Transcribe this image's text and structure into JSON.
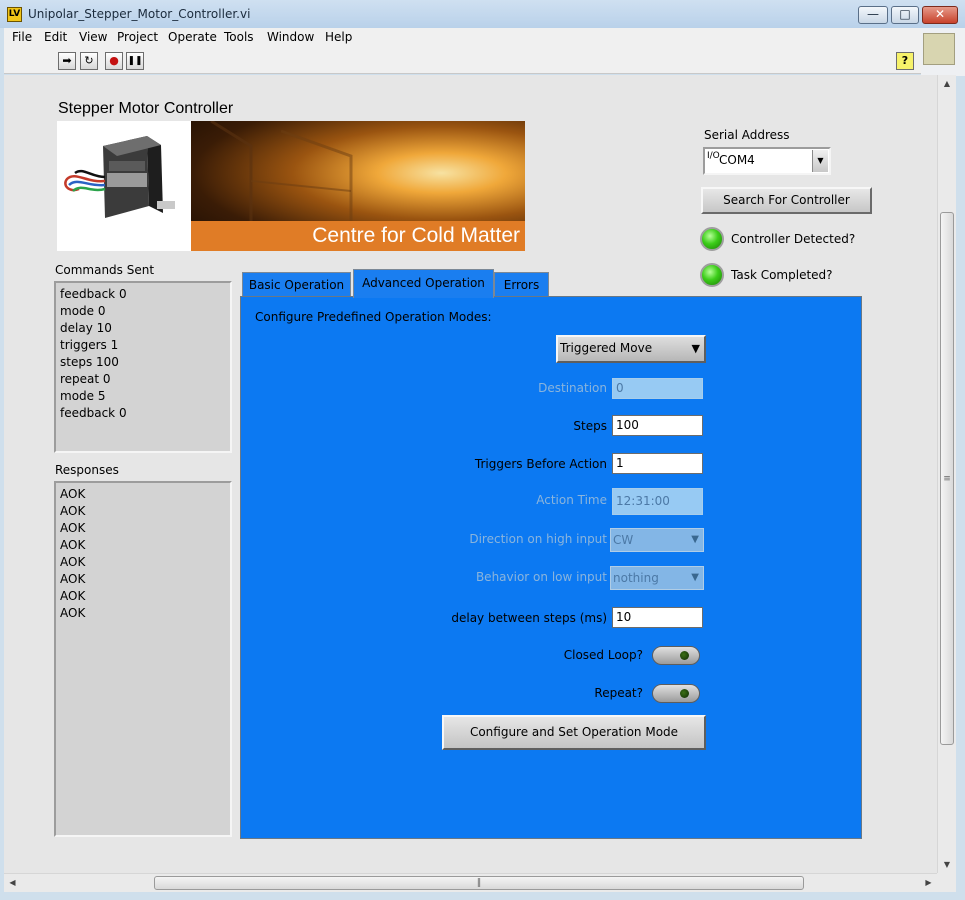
{
  "window": {
    "title": "Unipolar_Stepper_Motor_Controller.vi",
    "app_icon_glyph": "LV",
    "minimize_glyph": "—",
    "maximize_glyph": "□",
    "close_glyph": "✕"
  },
  "menu": [
    "File",
    "Edit",
    "View",
    "Project",
    "Operate",
    "Tools",
    "Window",
    "Help"
  ],
  "toolbar": {
    "icons": [
      "run-icon",
      "run-continuously-icon",
      "abort-icon",
      "pause-icon",
      "help-icon"
    ],
    "glyphs": {
      "run": "➡",
      "run_continuously": "↻",
      "abort": "●",
      "pause": "❚❚",
      "help": "?"
    }
  },
  "header": {
    "title": "Stepper Motor Controller"
  },
  "banner": {
    "text": "Centre for Cold Matter"
  },
  "commands": {
    "label": "Commands Sent",
    "items": [
      "feedback 0",
      "mode 0",
      "delay 10",
      "triggers 1",
      "steps 100",
      "repeat 0",
      "mode 5",
      "feedback 0"
    ]
  },
  "responses": {
    "label": "Responses",
    "items": [
      "AOK",
      "AOK",
      "AOK",
      "AOK",
      "AOK",
      "AOK",
      "AOK",
      "AOK"
    ]
  },
  "serial": {
    "label": "Serial Address",
    "io_glyph": "I/O",
    "value": "COM4",
    "arrow": "▼",
    "search_label": "Search For Controller"
  },
  "indicators": {
    "controller_label": "Controller Detected?",
    "controller_on": true,
    "task_label": "Task Completed?",
    "task_on": true,
    "led_color": "#3ccd19"
  },
  "tabs": {
    "basic": "Basic Operation",
    "advanced": "Advanced Operation",
    "errors": "Errors",
    "active": "advanced",
    "panel_color": "#0c79f2"
  },
  "advanced": {
    "heading": "Configure Predefined Operation Modes:",
    "mode_value": "Triggered Move",
    "mode_arrow": "▼",
    "destination_label": "Destination",
    "destination_value": "0",
    "steps_label": "Steps",
    "steps_value": "100",
    "triggers_label": "Triggers Before Action",
    "triggers_value": "1",
    "action_time_label": "Action Time",
    "action_time_value": "12:31:00",
    "direction_label": "Direction on high input",
    "direction_value": "CW",
    "behavior_label": "Behavior on low input",
    "behavior_value": "nothing",
    "delay_label": "delay between steps (ms)",
    "delay_value": "10",
    "closed_loop_label": "Closed Loop?",
    "closed_loop_on": false,
    "repeat_label": "Repeat?",
    "repeat_on": false,
    "configure_label": "Configure and Set Operation Mode"
  },
  "scrollbars": {
    "up": "▲",
    "down": "▼",
    "left": "◀",
    "right": "▶",
    "v_grip": "≡",
    "h_grip": "‖"
  }
}
